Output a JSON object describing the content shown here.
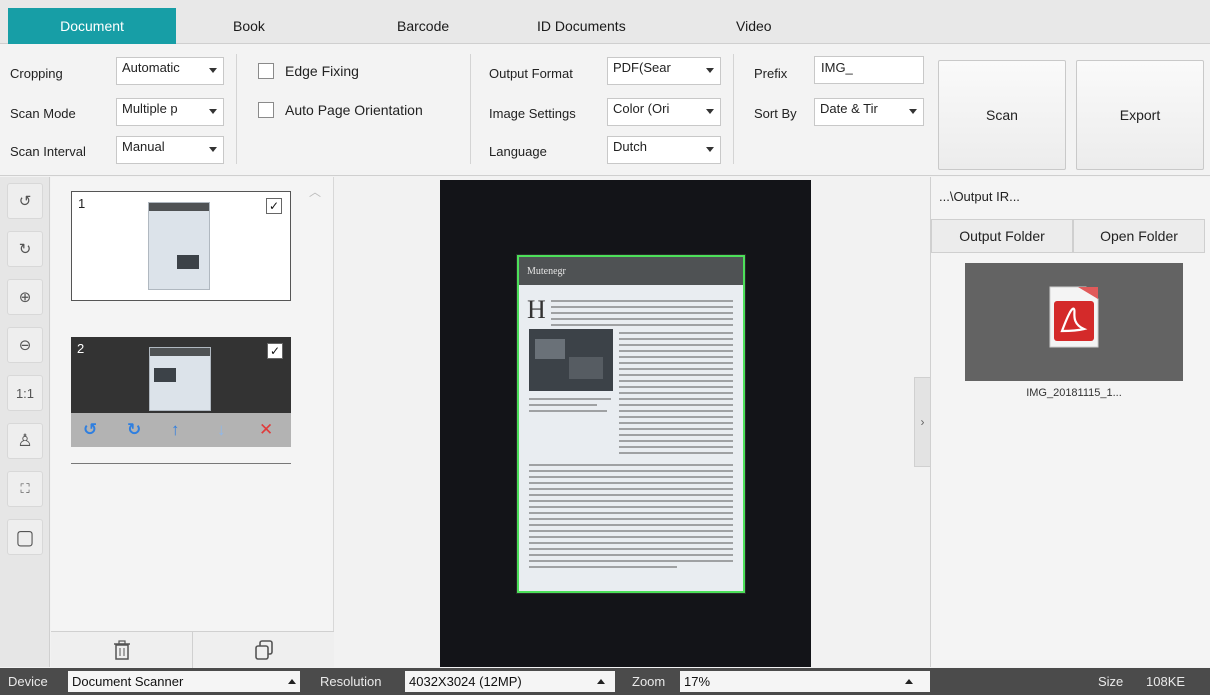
{
  "tabs": [
    {
      "label": "Document",
      "active": true
    },
    {
      "label": "Book"
    },
    {
      "label": "Barcode"
    },
    {
      "label": "ID Documents"
    },
    {
      "label": "Video"
    }
  ],
  "toolbar": {
    "cropping_label": "Cropping",
    "cropping_value": "Automatic",
    "scan_mode_label": "Scan Mode",
    "scan_mode_value": "Multiple p",
    "scan_interval_label": "Scan Interval",
    "scan_interval_value": "Manual",
    "edge_fixing_label": "Edge Fixing",
    "auto_orientation_label": "Auto Page Orientation",
    "output_format_label": "Output Format",
    "output_format_value": "PDF(Sear",
    "image_settings_label": "Image Settings",
    "image_settings_value": "Color (Ori",
    "language_label": "Language",
    "language_value": "Dutch",
    "prefix_label": "Prefix",
    "prefix_value": "IMG_",
    "sort_by_label": "Sort By",
    "sort_by_value": "Date & Tir",
    "scan_button": "Scan",
    "export_button": "Export"
  },
  "tools": [
    {
      "icon": "rotate-left-icon",
      "glyph": "↺"
    },
    {
      "icon": "rotate-right-icon",
      "glyph": "↻"
    },
    {
      "icon": "zoom-in-icon",
      "glyph": "⊕"
    },
    {
      "icon": "zoom-out-icon",
      "glyph": "⊖"
    },
    {
      "icon": "actual-size-icon",
      "glyph": "1:1"
    },
    {
      "icon": "stamp-icon",
      "glyph": "♙"
    },
    {
      "icon": "fit-icon",
      "glyph": "⛶"
    },
    {
      "icon": "crop-icon",
      "glyph": "▢"
    }
  ],
  "thumbnails": [
    {
      "number": "1",
      "checked": "✓"
    },
    {
      "number": "2",
      "checked": "✓"
    }
  ],
  "thumb_actions": {
    "rotate_left": "↺",
    "rotate_right": "↻",
    "move_up": "↑",
    "move_down": "↓",
    "delete": "✕"
  },
  "preview": {
    "doc_title": "Mutenegr"
  },
  "output": {
    "path": "...\\Output IR...",
    "output_folder_button": "Output Folder",
    "open_folder_button": "Open Folder",
    "file_name": "IMG_20181115_1..."
  },
  "status": {
    "device_label": "Device",
    "device_value": "Document Scanner",
    "resolution_label": "Resolution",
    "resolution_value": "4032X3024 (12MP)",
    "zoom_label": "Zoom",
    "zoom_value": "17%",
    "size_label": "Size",
    "size_value": "108KE"
  },
  "colors": {
    "accent": "#179ea6",
    "crop_border": "#4ce05a",
    "delete": "#e03b3b",
    "move": "#2f7fe0"
  }
}
